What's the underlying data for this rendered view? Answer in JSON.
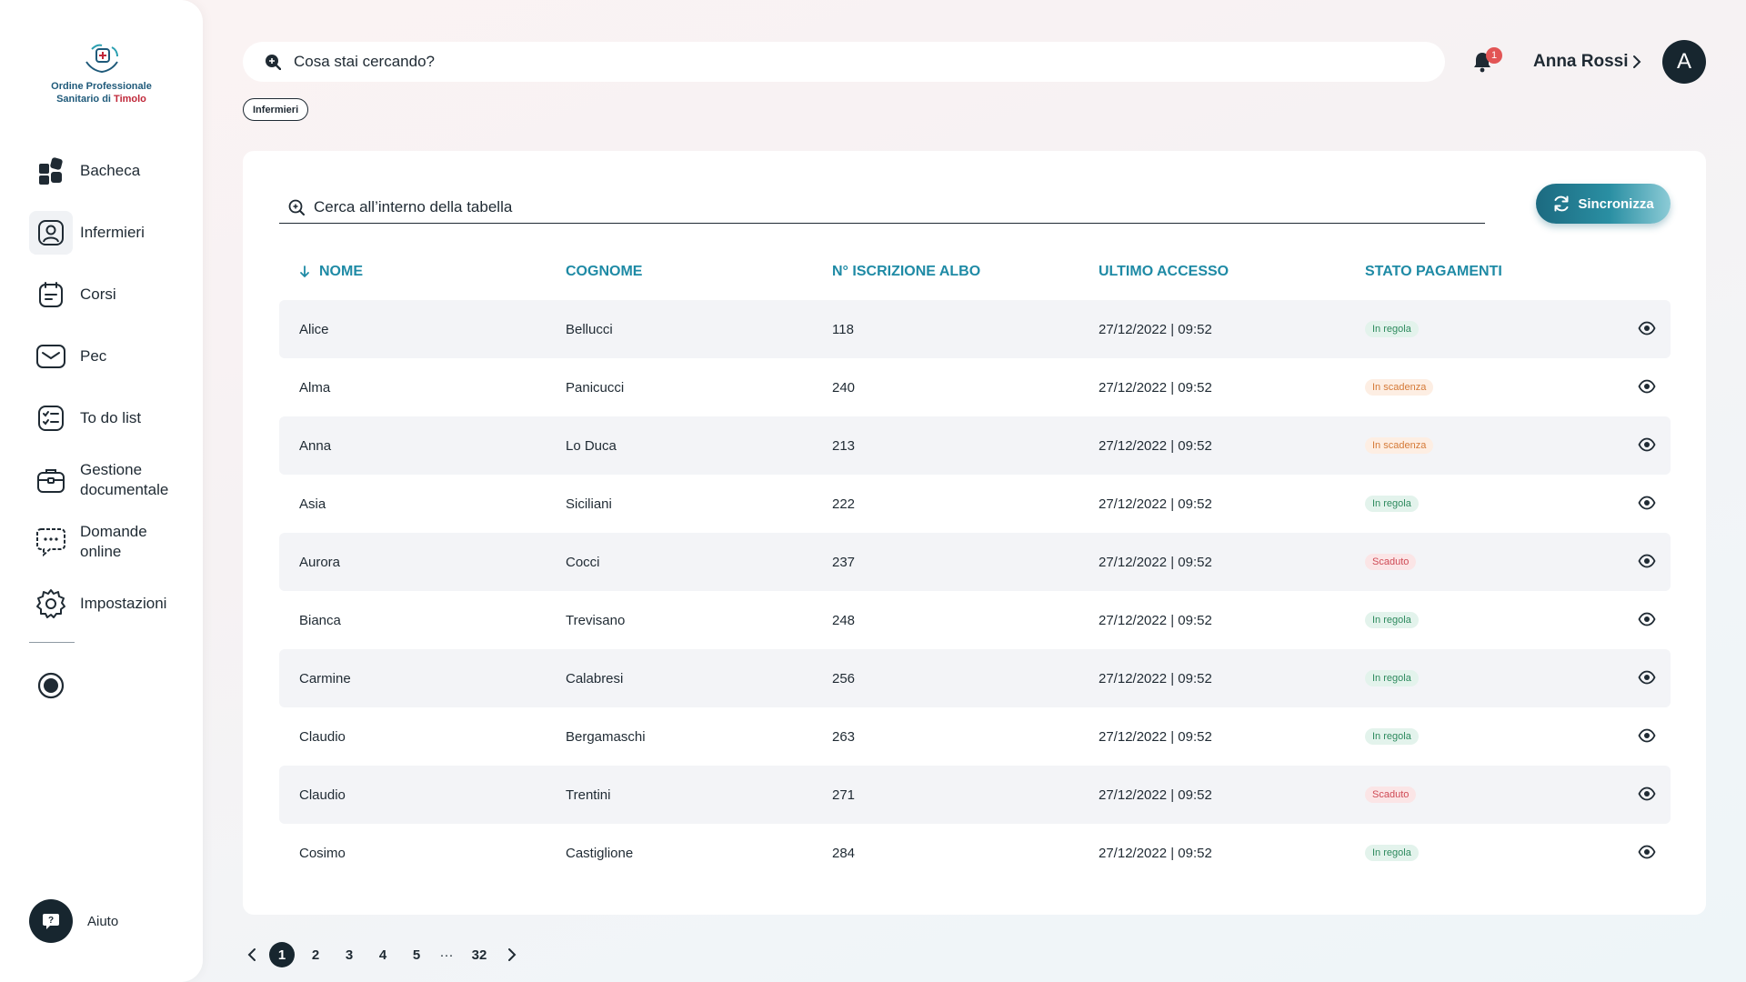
{
  "logo": {
    "line1": "Ordine Professionale",
    "line2_a": "Sanitario di ",
    "line2_b": "Timolo"
  },
  "sidebar": {
    "items": [
      {
        "label": "Bacheca",
        "icon": "dashboard-icon"
      },
      {
        "label": "Infermieri",
        "icon": "user-icon"
      },
      {
        "label": "Corsi",
        "icon": "course-icon"
      },
      {
        "label": "Pec",
        "icon": "mail-icon"
      },
      {
        "label": "To do list",
        "icon": "checklist-icon"
      },
      {
        "label": "Gestione\ndocumentale",
        "icon": "briefcase-icon"
      },
      {
        "label": "Domande\nonline",
        "icon": "chat-icon"
      },
      {
        "label": "Impostazioni",
        "icon": "gear-icon"
      }
    ],
    "active_index": 1,
    "help_label": "Aiuto"
  },
  "header": {
    "search_placeholder": "Cosa stai cercando?",
    "chip": "Infermieri",
    "notifications": "1",
    "user_name": "Anna Rossi",
    "avatar_initial": "A"
  },
  "table": {
    "search_placeholder": "Cerca all’interno della tabella",
    "sync_label": "Sincronizza",
    "columns": [
      "NOME",
      "COGNOME",
      "N° ISCRIZIONE ALBO",
      "ULTIMO ACCESSO",
      "STATO PAGAMENTI"
    ],
    "rows": [
      {
        "nome": "Alice",
        "cognome": "Bellucci",
        "num": "118",
        "accesso": "27/12/2022 | 09:52",
        "stato": "In regola",
        "tipo": "ok"
      },
      {
        "nome": "Alma",
        "cognome": "Panicucci",
        "num": "240",
        "accesso": "27/12/2022 | 09:52",
        "stato": "In scadenza",
        "tipo": "warn"
      },
      {
        "nome": "Anna",
        "cognome": "Lo Duca",
        "num": "213",
        "accesso": "27/12/2022 | 09:52",
        "stato": "In scadenza",
        "tipo": "warn"
      },
      {
        "nome": "Asia",
        "cognome": "Siciliani",
        "num": "222",
        "accesso": "27/12/2022 | 09:52",
        "stato": "In regola",
        "tipo": "ok"
      },
      {
        "nome": "Aurora",
        "cognome": "Cocci",
        "num": "237",
        "accesso": "27/12/2022 | 09:52",
        "stato": "Scaduto",
        "tipo": "ko"
      },
      {
        "nome": "Bianca",
        "cognome": "Trevisano",
        "num": "248",
        "accesso": "27/12/2022 | 09:52",
        "stato": "In regola",
        "tipo": "ok"
      },
      {
        "nome": "Carmine",
        "cognome": "Calabresi",
        "num": "256",
        "accesso": "27/12/2022 | 09:52",
        "stato": "In regola",
        "tipo": "ok"
      },
      {
        "nome": "Claudio",
        "cognome": "Bergamaschi",
        "num": "263",
        "accesso": "27/12/2022 | 09:52",
        "stato": "In regola",
        "tipo": "ok"
      },
      {
        "nome": "Claudio",
        "cognome": "Trentini",
        "num": "271",
        "accesso": "27/12/2022 | 09:52",
        "stato": "Scaduto",
        "tipo": "ko"
      },
      {
        "nome": "Cosimo",
        "cognome": "Castiglione",
        "num": "284",
        "accesso": "27/12/2022 | 09:52",
        "stato": "In regola",
        "tipo": "ok"
      }
    ]
  },
  "pagination": {
    "pages": [
      "1",
      "2",
      "3",
      "4",
      "5"
    ],
    "ellipsis": "···",
    "last": "32",
    "current": "1"
  }
}
